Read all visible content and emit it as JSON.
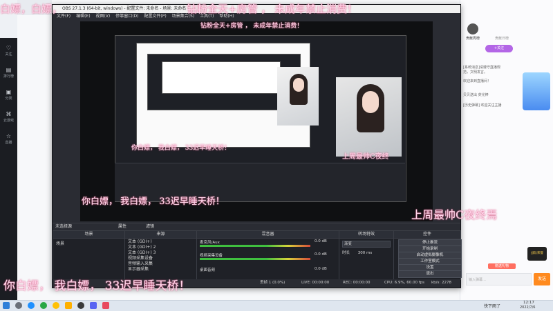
{
  "overlays": {
    "top_banner": "钻粉全天+房管 ， 未成年禁止消费！",
    "top_banner_small": "钻粉全天+房管 ， 未成年禁止消费！",
    "left_top_fragment": "白嫖，白嫖，",
    "caption_large": "你白嫖， 我白嫖， 33迟早睡天桥！",
    "caption_mid": "你白嫖， 我白嫖， 33迟早睡天桥！",
    "caption_small": "你白嫖， 我白嫖， 33迟早睡天桥！",
    "webcam_caption": "上周最帅C夜终焉",
    "webcam_caption_small": "上周最帅C夜终"
  },
  "obs": {
    "title": "OBS 27.1.3 (64-bit, windows) - 配置文件: 未命名 - 场景: 未命名",
    "menu": [
      "文件(F)",
      "编辑(E)",
      "视图(V)",
      "停靠窗口(D)",
      "配置文件(P)",
      "场景集合(S)",
      "工具(T)",
      "帮助(H)"
    ],
    "no_source": "未选择源",
    "props_btn": "属性",
    "filter_btn": "滤镜",
    "panels": {
      "scenes": "场景",
      "sources": "来源",
      "mixer": "混音器",
      "transitions": "转场特效",
      "controls": "控件"
    },
    "scene_item": "场景",
    "sources": [
      "文本 (GDI+)",
      "文本 (GDI+) 2",
      "文本 (GDI+) 3",
      "视频采集设备",
      "音频输入采集",
      "显示器采集"
    ],
    "mixer_items": [
      {
        "name": "麦克风/Aux",
        "db": "0.0 dB"
      },
      {
        "name": "视频采集设备",
        "db": "0.0 dB"
      },
      {
        "name": "桌面音频",
        "db": "0.0 dB"
      }
    ],
    "transition": {
      "type": "渐变",
      "duration_label": "时长",
      "duration": "300 ms"
    },
    "controls": [
      "停止推流",
      "开始录制",
      "启动虚拟摄像机",
      "工作室模式",
      "设置",
      "退出"
    ],
    "status": {
      "dropped": "丢帧 1 (0.0%)",
      "live": "LIVE: 00:00:00",
      "rec": "REC: 00:00:00",
      "cpu": "CPU: 6.9%, 60.00 fps",
      "bitrate": "kb/s: 2278"
    }
  },
  "sidebar": [
    {
      "icon": "heart-icon",
      "label": "关注"
    },
    {
      "icon": "rank-icon",
      "label": "排行榜"
    },
    {
      "icon": "box-icon",
      "label": "分类"
    },
    {
      "icon": "game-icon",
      "label": "云游戏"
    },
    {
      "icon": "star-icon",
      "label": "直播"
    }
  ],
  "right_panel": {
    "tabs": [
      "贡献周榜",
      "贡献日榜"
    ],
    "follow_btn": "+关注",
    "chat": [
      "[系统消息]请遵守直播规范，文明发言。",
      "欢迎来到直播间！",
      "贝贝送出 荧光棒",
      "[历史弹幕] 欢迎关注主播"
    ],
    "badge": "战队荣誉",
    "gift_btn": "赠送礼物",
    "send_btn": "发送",
    "input_placeholder": "输入弹幕…"
  },
  "taskbar": {
    "weather": "快下雨了",
    "time": "12:17",
    "date": "2022/7/6"
  }
}
